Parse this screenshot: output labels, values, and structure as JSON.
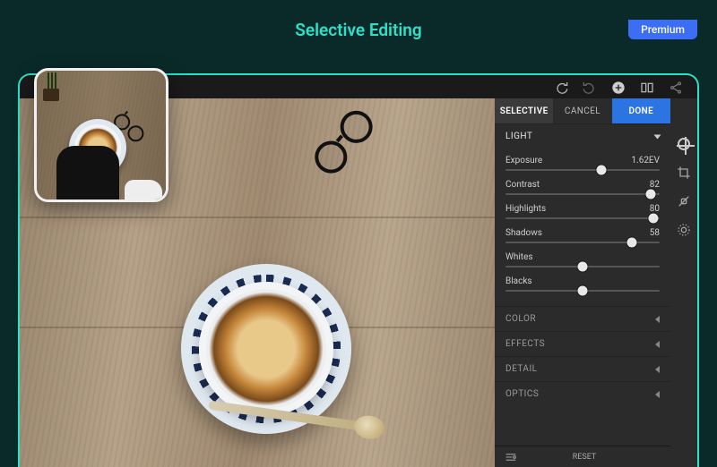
{
  "badge": {
    "premium": "Premium"
  },
  "page_title": "Selective Editing",
  "tabs": {
    "selective": "SELECTIVE",
    "cancel": "CANCEL",
    "done": "DONE"
  },
  "sections": {
    "light": "LIGHT",
    "color": "COLOR",
    "effects": "EFFECTS",
    "detail": "DETAIL",
    "optics": "OPTICS"
  },
  "sliders": {
    "exposure": {
      "label": "Exposure",
      "value": "1.62EV",
      "pct": 62
    },
    "contrast": {
      "label": "Contrast",
      "value": "82",
      "pct": 94
    },
    "highlights": {
      "label": "Highlights",
      "value": "80",
      "pct": 96
    },
    "shadows": {
      "label": "Shadows",
      "value": "58",
      "pct": 82
    },
    "whites": {
      "label": "Whites",
      "value": "",
      "pct": 50
    },
    "blacks": {
      "label": "Blacks",
      "value": "",
      "pct": 50
    }
  },
  "footer": {
    "reset": "RESET"
  },
  "icons": {
    "redo": "redo-icon",
    "undo": "undo-icon",
    "add": "add-icon",
    "compare": "compare-icon",
    "share": "share-icon",
    "adjust": "adjust-icon",
    "crop": "crop-icon",
    "heal": "heal-icon",
    "selective": "selective-icon",
    "presets": "presets-icon"
  }
}
